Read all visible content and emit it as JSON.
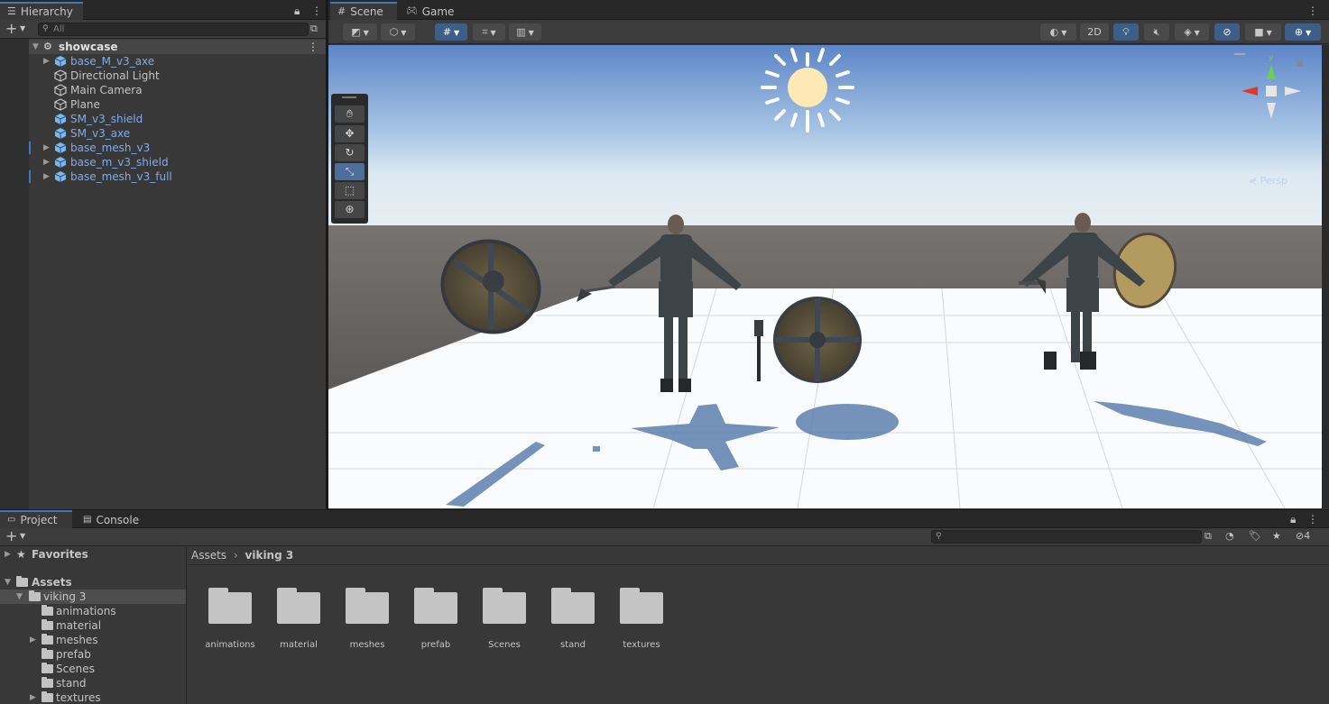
{
  "hierarchy": {
    "tab_label": "Hierarchy",
    "search_placeholder": "All",
    "scene_name": "showcase",
    "items": [
      {
        "label": "base_M_v3_axe",
        "prefab": true,
        "expandable": true
      },
      {
        "label": "Directional Light",
        "prefab": false,
        "expandable": false
      },
      {
        "label": "Main Camera",
        "prefab": false,
        "expandable": false
      },
      {
        "label": "Plane",
        "prefab": false,
        "expandable": false
      },
      {
        "label": "SM_v3_shield",
        "prefab": true,
        "expandable": false
      },
      {
        "label": "SM_v3_axe",
        "prefab": true,
        "expandable": false
      },
      {
        "label": "base_mesh_v3",
        "prefab": true,
        "expandable": true
      },
      {
        "label": "base_m_v3_shield",
        "prefab": true,
        "expandable": true
      },
      {
        "label": "base_mesh_v3_full",
        "prefab": true,
        "expandable": true
      }
    ]
  },
  "scene_view": {
    "tabs": [
      "Scene",
      "Game"
    ],
    "toolbar": {
      "mode_2d": "2D"
    },
    "gizmo": {
      "y_label": "y",
      "camera_mode": "Persp"
    },
    "tools": [
      "hand-tool",
      "move-tool",
      "rotate-tool",
      "scale-tool",
      "rect-tool",
      "transform-tool"
    ]
  },
  "project": {
    "tabs": [
      "Project",
      "Console"
    ],
    "hidden_count": "4",
    "tree": {
      "favorites": "Favorites",
      "assets": "Assets",
      "selected": "viking 3",
      "children": [
        "animations",
        "material",
        "meshes",
        "prefab",
        "Scenes",
        "stand",
        "textures"
      ]
    },
    "breadcrumb": [
      "Assets",
      "viking 3"
    ],
    "folders": [
      "animations",
      "material",
      "meshes",
      "prefab",
      "Scenes",
      "stand",
      "textures"
    ]
  },
  "colors": {
    "accent": "#3a79bb",
    "prefab_text": "#7cacf0",
    "panel": "#383838"
  }
}
